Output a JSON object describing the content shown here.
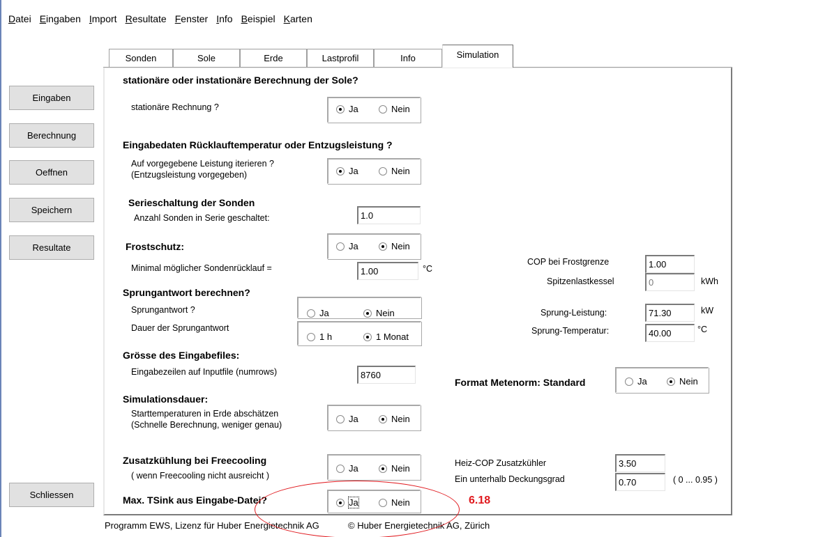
{
  "menu": [
    "Datei",
    "Eingaben",
    "Import",
    "Resultate",
    "Fenster",
    "Info",
    "Beispiel",
    "Karten"
  ],
  "menu_ul": [
    "D",
    "E",
    "I",
    "R",
    "F",
    "I",
    "B",
    "K"
  ],
  "menu_rest": [
    "atei",
    "ingaben",
    "mport",
    "esultate",
    "enster",
    "nfo",
    "eispiel",
    "arten"
  ],
  "tabs": [
    "Sonden",
    "Sole",
    "Erde",
    "Lastprofil",
    "Info",
    "Simulation"
  ],
  "side_buttons": [
    "Eingaben",
    "Berechnung",
    "Oeffnen",
    "Speichern",
    "Resultate"
  ],
  "close_button": "Schliessen",
  "yes": "Ja",
  "no": "Nein",
  "sec1": {
    "title": "stationäre oder instationäre Berechnung der Sole?",
    "label": "stationäre Rechnung ?"
  },
  "sec2": {
    "title": "Eingabedaten Rücklauftemperatur oder Entzugsleistung ?",
    "label1": "Auf vorgegebene Leistung iterieren ?",
    "label2": "(Entzugsleistung vorgegeben)"
  },
  "sec3": {
    "title": "Serieschaltung der Sonden",
    "label": "Anzahl Sonden in Serie geschaltet:",
    "value": "1.0"
  },
  "sec4": {
    "title": "Frostschutz:",
    "label": "Minimal möglicher Sondenrücklauf =",
    "value": "1.00",
    "unit": "°C"
  },
  "sec5": {
    "title": "Sprungantwort berechnen?",
    "label1": "Sprungantwort ?",
    "label2": "Dauer der Sprungantwort",
    "opt_1h": "1 h",
    "opt_month": "1 Monat"
  },
  "sec6": {
    "title": "Grösse des Eingabefiles:",
    "label": "Eingabezeilen auf Inputfile (numrows)",
    "value": "8760"
  },
  "sec7": {
    "title": "Simulationsdauer:",
    "label1": "Starttemperaturen in Erde abschätzen",
    "label2": "(Schnelle Berechnung, weniger genau)"
  },
  "sec8": {
    "title": "Zusatzkühlung bei Freecooling",
    "label": "( wenn Freecooling nicht ausreicht )"
  },
  "sec9": {
    "title": "Max. TSink aus Eingabe-Datei?"
  },
  "right": {
    "cop_label": "COP bei Frostgrenze",
    "cop_value": "1.00",
    "spitz_label": "Spitzenlastkessel",
    "spitz_value": "0",
    "spitz_unit": "kWh",
    "sl_label": "Sprung-Leistung:",
    "sl_value": "71.30",
    "sl_unit": "kW",
    "st_label": "Sprung-Temperatur:",
    "st_value": "40.00",
    "st_unit": "°C",
    "metenorm_label": "Format Metenorm: Standard",
    "heiz_label": "Heiz-COP Zusatzkühler",
    "heiz_value": "3.50",
    "deck_label": "Ein unterhalb Deckungsgrad",
    "deck_value": "0.70",
    "deck_range": "( 0 ... 0.95 )"
  },
  "status": {
    "left": "Programm EWS, Lizenz für Huber Energietechnik AG",
    "right": "© Huber Energietechnik AG, Zürich"
  },
  "annotation": {
    "text": "6.18",
    "color": "#e0191e"
  }
}
